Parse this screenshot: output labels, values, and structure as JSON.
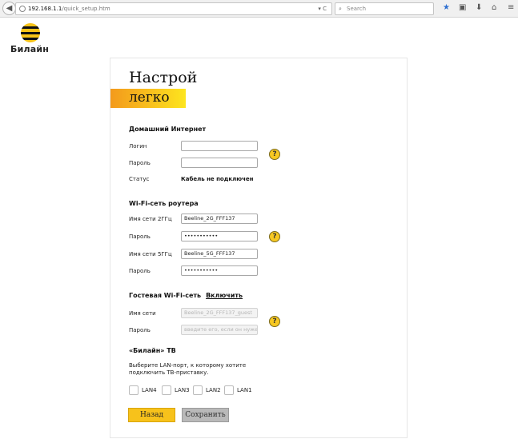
{
  "browser": {
    "url_host": "192.168.1.1",
    "url_path": "/quick_setup.htm",
    "url_controls": "▾ C",
    "search_placeholder": "Search"
  },
  "brand": {
    "name": "Билайн",
    "accent": "#f7c21b"
  },
  "hero": {
    "line1": "Настрой",
    "line2": "легко"
  },
  "internet": {
    "title": "Домашний Интернет",
    "login_label": "Логин",
    "login_value": "",
    "password_label": "Пароль",
    "password_value": "",
    "status_label": "Статус",
    "status_value": "Кабель не подключен"
  },
  "wifi": {
    "title": "Wi-Fi-сеть роутера",
    "ssid24_label": "Имя сети 2ГГц",
    "ssid24_value": "Beeline_2G_FFF137",
    "pass24_label": "Пароль",
    "pass24_value": "•••••••••••",
    "ssid5_label": "Имя сети 5ГГц",
    "ssid5_value": "Beeline_5G_FFF137",
    "pass5_label": "Пароль",
    "pass5_value": "•••••••••••"
  },
  "guest": {
    "title": "Гостевая Wi-Fi-сеть",
    "enable_link": "Включить",
    "ssid_label": "Имя сети",
    "ssid_value": "Beeline_2G_FFF137_guest",
    "pass_label": "Пароль",
    "pass_placeholder": "введите его, если он нужен"
  },
  "tv": {
    "title": "«Билайн» ТВ",
    "description": "Выберите LAN-порт, к которому хотите подключить ТВ-приставку.",
    "ports": [
      "LAN4",
      "LAN3",
      "LAN2",
      "LAN1"
    ]
  },
  "buttons": {
    "back": "Назад",
    "save": "Сохранить"
  }
}
